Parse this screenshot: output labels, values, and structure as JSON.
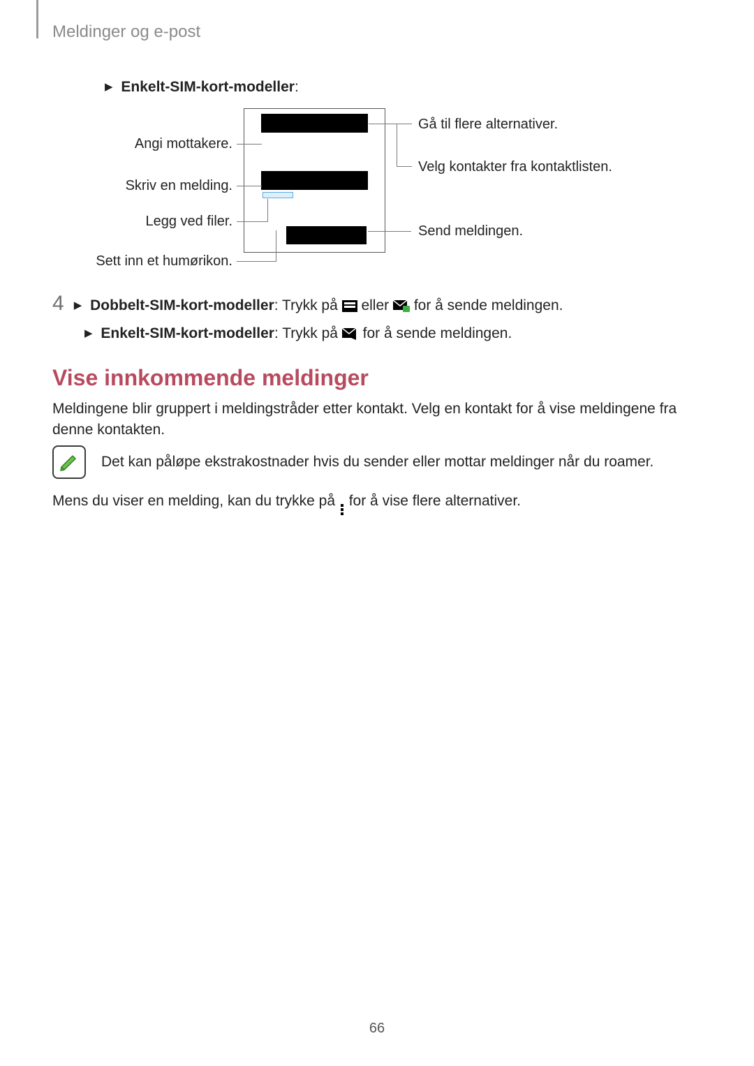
{
  "header": {
    "breadcrumb": "Meldinger og e-post"
  },
  "step3": {
    "title_prefix": "Enkelt-SIM-kort-modeller",
    "title_suffix": ":"
  },
  "diagram": {
    "left": {
      "recipients": "Angi mottakere.",
      "write": "Skriv en melding.",
      "attach": "Legg ved filer.",
      "emoji": "Sett inn et humørikon."
    },
    "right": {
      "more_options": "Gå til flere alternativer.",
      "contacts": "Velg kontakter fra kontaktlisten.",
      "send": "Send meldingen."
    }
  },
  "step4": {
    "number": "4",
    "dual_bold": "Dobbelt-SIM-kort-modeller",
    "dual_pre": ": Trykk på ",
    "dual_mid": " eller ",
    "dual_post": " for å sende meldingen.",
    "single_bold": "Enkelt-SIM-kort-modeller",
    "single_pre": ": Trykk på ",
    "single_post": " for å sende meldingen."
  },
  "section": {
    "heading": "Vise innkommende meldinger",
    "para": "Meldingene blir gruppert i meldingstråder etter kontakt. Velg en kontakt for å vise meldingene fra denne kontakten.",
    "note": "Det kan påløpe ekstrakostnader hvis du sender eller mottar meldinger når du roamer.",
    "para2_pre": "Mens du viser en melding, kan du trykke på ",
    "para2_post": " for å vise flere alternativer."
  },
  "page_number": "66"
}
